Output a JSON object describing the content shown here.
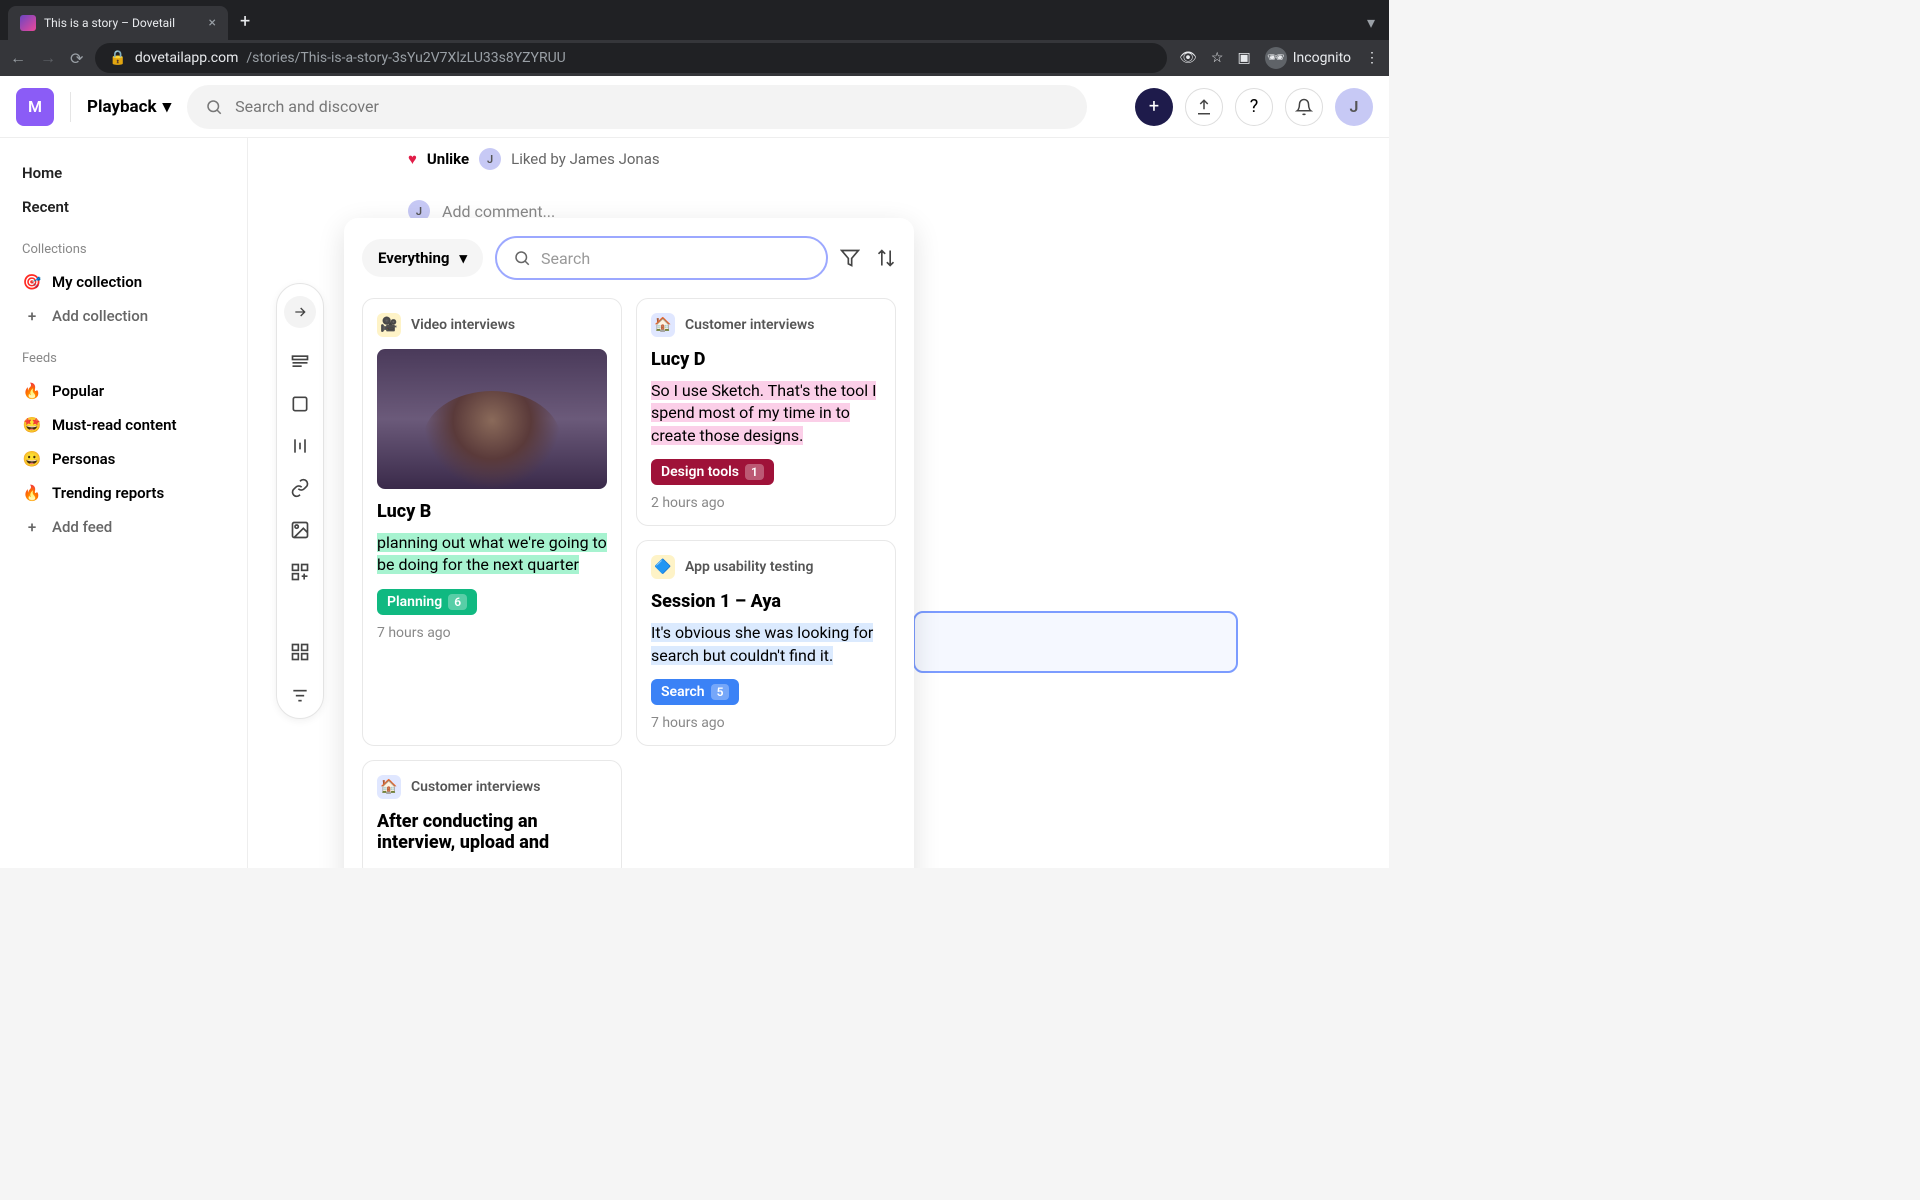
{
  "browser": {
    "tab_title": "This is a story – Dovetail",
    "url_host": "dovetailapp.com",
    "url_path": "/stories/This-is-a-story-3sYu2V7XlzLU33s8YZYRUU",
    "incognito_label": "Incognito"
  },
  "header": {
    "workspace_letter": "M",
    "playback_label": "Playback",
    "search_placeholder": "Search and discover",
    "avatar_letter": "J"
  },
  "sidebar": {
    "nav": [
      "Home",
      "Recent"
    ],
    "collections_label": "Collections",
    "collections": [
      {
        "icon": "🎯",
        "label": "My collection"
      }
    ],
    "add_collection": "Add collection",
    "feeds_label": "Feeds",
    "feeds": [
      {
        "icon": "🔥",
        "label": "Popular"
      },
      {
        "icon": "🤩",
        "label": "Must-read content"
      },
      {
        "icon": "😀",
        "label": "Personas"
      },
      {
        "icon": "🔥",
        "label": "Trending reports"
      }
    ],
    "add_feed": "Add feed"
  },
  "content": {
    "unlike_label": "Unlike",
    "liked_by": "Liked by James Jonas",
    "liker_initial": "J",
    "comment_placeholder": "Add comment...",
    "commenter_initial": "J"
  },
  "panel": {
    "filter_label": "Everything",
    "search_placeholder": "Search",
    "cards": [
      {
        "project_icon": "🎥",
        "project": "Video interviews",
        "has_video": true,
        "title": "Lucy B",
        "quote": "planning out what we're going to be doing for the next quarter",
        "highlight": "teal",
        "tag": {
          "label": "Planning",
          "count": "6",
          "color": "teal"
        },
        "time": "7 hours ago"
      },
      {
        "project_icon": "🏠",
        "project": "Customer interviews",
        "has_video": false,
        "title": "Lucy D",
        "quote": "So I use Sketch. That's the tool I spend most of my time in to create those designs.",
        "highlight": "pink",
        "tag": {
          "label": "Design tools",
          "count": "1",
          "color": "maroon"
        },
        "time": "2 hours ago"
      },
      {
        "project_icon": "🏠",
        "project": "Customer interviews",
        "has_video": false,
        "title": "After conducting an interview, upload and",
        "quote": "",
        "highlight": "",
        "tag": null,
        "time": ""
      },
      {
        "project_icon": "🔷",
        "project": "App usability testing",
        "has_video": false,
        "title": "Session 1 – Aya",
        "quote": "It's obvious she was looking for search but couldn't find it.",
        "highlight": "blue",
        "tag": {
          "label": "Search",
          "count": "5",
          "color": "blue"
        },
        "time": "7 hours ago"
      }
    ]
  }
}
